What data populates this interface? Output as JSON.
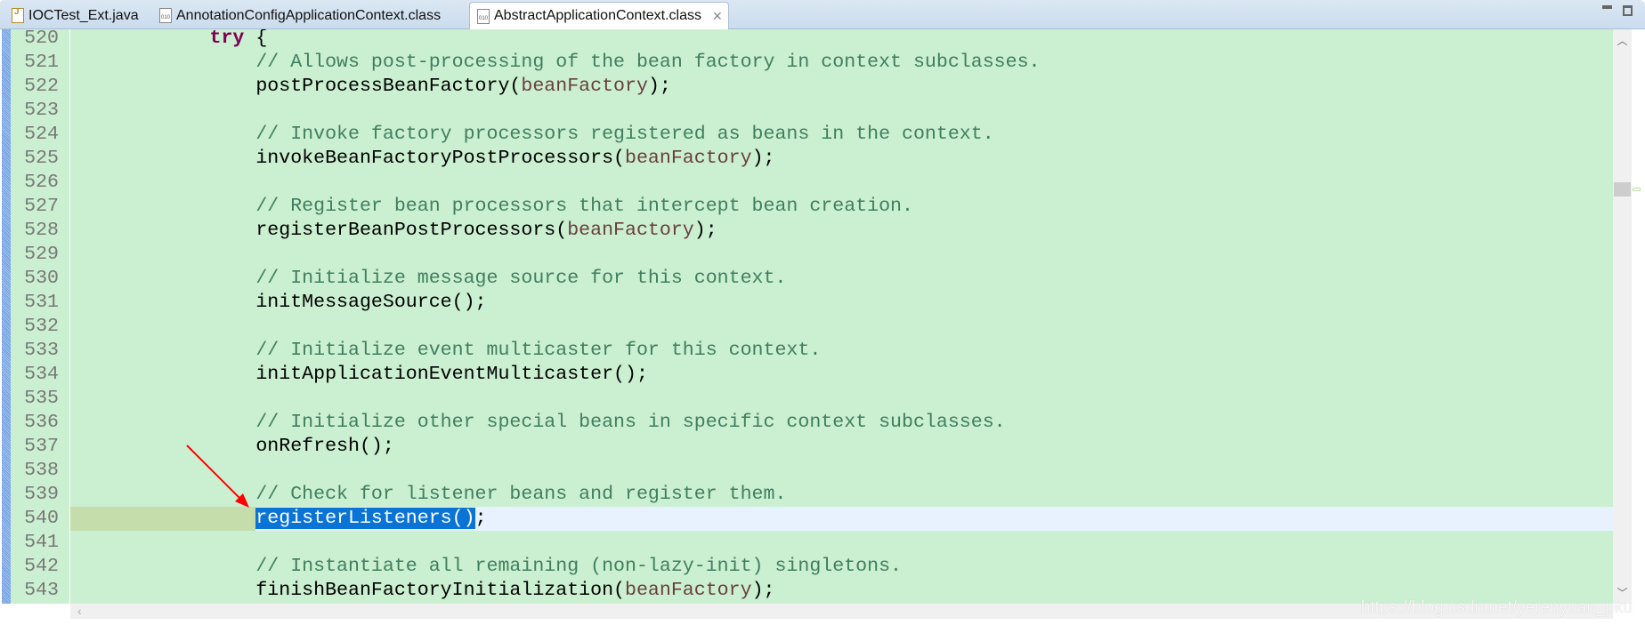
{
  "tabs": [
    {
      "label": "IOCTest_Ext.java",
      "icon": "java-file-icon",
      "active": false
    },
    {
      "label": "AnnotationConfigApplicationContext.class",
      "icon": "class-file-icon",
      "active": false
    },
    {
      "label": "AbstractApplicationContext.class",
      "icon": "class-file-icon",
      "active": true
    }
  ],
  "class_icon_text": "010",
  "close_glyph": "✕",
  "current_line": 540,
  "code": [
    {
      "n": "520",
      "parts": [
        [
          "tx",
          "            "
        ],
        [
          "kw",
          "try"
        ],
        [
          "tx",
          " {"
        ]
      ]
    },
    {
      "n": "521",
      "parts": [
        [
          "cm",
          "                // Allows post-processing of the bean factory in context subclasses."
        ]
      ]
    },
    {
      "n": "522",
      "parts": [
        [
          "tx",
          "                postProcessBeanFactory("
        ],
        [
          "lv",
          "beanFactory"
        ],
        [
          "tx",
          ");"
        ]
      ]
    },
    {
      "n": "523",
      "parts": []
    },
    {
      "n": "524",
      "parts": [
        [
          "cm",
          "                // Invoke factory processors registered as beans in the context."
        ]
      ]
    },
    {
      "n": "525",
      "parts": [
        [
          "tx",
          "                invokeBeanFactoryPostProcessors("
        ],
        [
          "lv",
          "beanFactory"
        ],
        [
          "tx",
          ");"
        ]
      ]
    },
    {
      "n": "526",
      "parts": []
    },
    {
      "n": "527",
      "parts": [
        [
          "cm",
          "                // Register bean processors that intercept bean creation."
        ]
      ]
    },
    {
      "n": "528",
      "parts": [
        [
          "tx",
          "                registerBeanPostProcessors("
        ],
        [
          "lv",
          "beanFactory"
        ],
        [
          "tx",
          ");"
        ]
      ]
    },
    {
      "n": "529",
      "parts": []
    },
    {
      "n": "530",
      "parts": [
        [
          "cm",
          "                // Initialize message source for this context."
        ]
      ]
    },
    {
      "n": "531",
      "parts": [
        [
          "tx",
          "                initMessageSource();"
        ]
      ]
    },
    {
      "n": "532",
      "parts": []
    },
    {
      "n": "533",
      "parts": [
        [
          "cm",
          "                // Initialize event multicaster for this context."
        ]
      ]
    },
    {
      "n": "534",
      "parts": [
        [
          "tx",
          "                initApplicationEventMulticaster();"
        ]
      ]
    },
    {
      "n": "535",
      "parts": []
    },
    {
      "n": "536",
      "parts": [
        [
          "cm",
          "                // Initialize other special beans in specific context subclasses."
        ]
      ]
    },
    {
      "n": "537",
      "parts": [
        [
          "tx",
          "                onRefresh();"
        ]
      ]
    },
    {
      "n": "538",
      "parts": []
    },
    {
      "n": "539",
      "parts": [
        [
          "cm",
          "                // Check for listener beans and register them."
        ]
      ]
    },
    {
      "n": "540",
      "parts": [
        [
          "tx",
          "                "
        ],
        [
          "sel",
          "registerListeners()"
        ],
        [
          "tx",
          ";"
        ]
      ]
    },
    {
      "n": "541",
      "parts": []
    },
    {
      "n": "542",
      "parts": [
        [
          "cm",
          "                // Instantiate all remaining (non-lazy-init) singletons."
        ]
      ]
    },
    {
      "n": "543",
      "parts": [
        [
          "tx",
          "                finishBeanFactoryInitialization("
        ],
        [
          "lv",
          "beanFactory"
        ],
        [
          "tx",
          ");"
        ]
      ]
    }
  ],
  "scroll_left_glyph": "‹",
  "scroll_up_glyph": "︿",
  "scroll_down_glyph": "﹀",
  "watermark": "https://blog.csdn.net/yerenyuan_pku",
  "colors": {
    "editor_bg": "#cbefd1",
    "comment": "#3f7f5f",
    "keyword": "#7f0055",
    "local_var": "#6a3e3e",
    "selection": "#0a74d6",
    "annotation_arrow": "#ff0000"
  }
}
